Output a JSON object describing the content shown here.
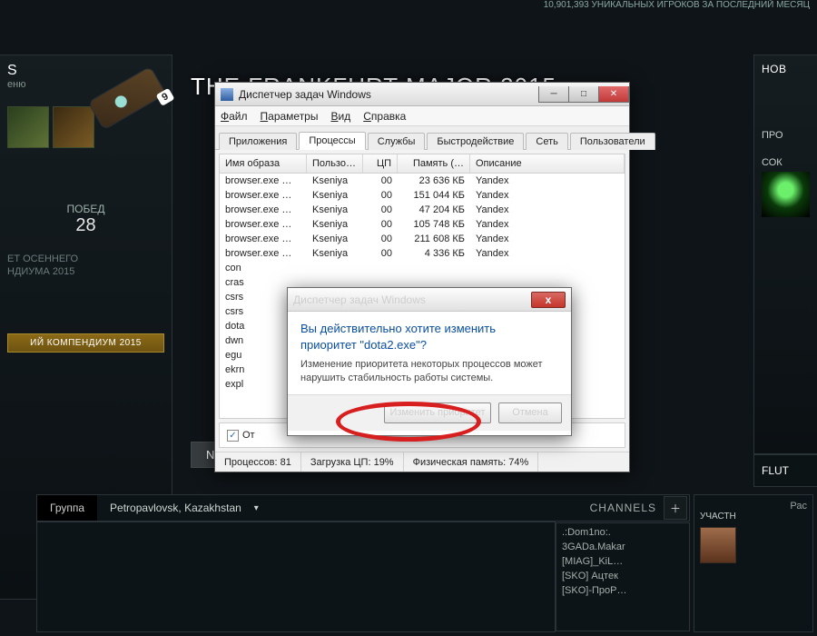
{
  "bg": {
    "stat_number": "10,901,393",
    "stat_text": "УНИКАЛЬНЫХ ИГРОКОВ ЗА ПОСЛЕДНИЙ МЕСЯЦ",
    "banner": "THE FRANKFURT MAJOR 2015",
    "next": "Next",
    "left": {
      "menu": "еню",
      "s_label": "S",
      "wand_badge": "9",
      "wins_label": "ПОБЕД",
      "wins_count": "28",
      "autumn_l1": "ЕТ ОСЕННЕГО",
      "autumn_l2": "НДИУМА 2015",
      "compendium": "ИЙ КОМПЕНДИУМ 2015"
    },
    "right": {
      "news": "НОВ",
      "pro": "ПРО",
      "cok": "СОК",
      "flut": "FLUT"
    },
    "chat": {
      "group": "Группа",
      "location": "Petropavlovsk, Kazakhstan",
      "channels_label": "CHANNELS",
      "items": [
        ".:Dom1no:.",
        "3GADa.Makar",
        "[MIAG]_KiL…",
        "[SKO] Ацтек",
        "[SKO]-ПроР…"
      ],
      "right_label": "Рас",
      "right_h": "УЧАСТН"
    }
  },
  "tm": {
    "title": "Диспетчер задач Windows",
    "menu": {
      "file": "Файл",
      "options": "Параметры",
      "view": "Вид",
      "help": "Справка"
    },
    "tabs": [
      "Приложения",
      "Процессы",
      "Службы",
      "Быстродействие",
      "Сеть",
      "Пользователи"
    ],
    "active_tab": 1,
    "columns": [
      "Имя образа",
      "Пользо…",
      "ЦП",
      "Память (…",
      "Описание"
    ],
    "rows": [
      {
        "img": "browser.exe …",
        "user": "Kseniya",
        "cpu": "00",
        "mem": "23 636 КБ",
        "desc": "Yandex"
      },
      {
        "img": "browser.exe …",
        "user": "Kseniya",
        "cpu": "00",
        "mem": "151 044 КБ",
        "desc": "Yandex"
      },
      {
        "img": "browser.exe …",
        "user": "Kseniya",
        "cpu": "00",
        "mem": "47 204 КБ",
        "desc": "Yandex"
      },
      {
        "img": "browser.exe …",
        "user": "Kseniya",
        "cpu": "00",
        "mem": "105 748 КБ",
        "desc": "Yandex"
      },
      {
        "img": "browser.exe …",
        "user": "Kseniya",
        "cpu": "00",
        "mem": "211 608 КБ",
        "desc": "Yandex"
      },
      {
        "img": "browser.exe …",
        "user": "Kseniya",
        "cpu": "00",
        "mem": "4 336 КБ",
        "desc": "Yandex"
      },
      {
        "img": "con",
        "user": "",
        "cpu": "",
        "mem": "",
        "desc": ""
      },
      {
        "img": "cras",
        "user": "",
        "cpu": "",
        "mem": "",
        "desc": ""
      },
      {
        "img": "csrs",
        "user": "",
        "cpu": "",
        "mem": "",
        "desc": ""
      },
      {
        "img": "csrs",
        "user": "",
        "cpu": "",
        "mem": "",
        "desc": ""
      },
      {
        "img": "dota",
        "user": "",
        "cpu": "",
        "mem": "",
        "desc": ""
      },
      {
        "img": "dwn",
        "user": "",
        "cpu": "",
        "mem": "",
        "desc": ""
      },
      {
        "img": "egu",
        "user": "",
        "cpu": "",
        "mem": "",
        "desc": ""
      },
      {
        "img": "ekrn",
        "user": "",
        "cpu": "",
        "mem": "",
        "desc": ""
      },
      {
        "img": "expl",
        "user": "",
        "cpu": "",
        "mem": "",
        "desc": ""
      }
    ],
    "show_all": "От",
    "status": {
      "proc": "Процессов: 81",
      "cpu": "Загрузка ЦП: 19%",
      "mem": "Физическая память: 74%"
    }
  },
  "dlg": {
    "title": "Диспетчер задач Windows",
    "main_l1": "Вы действительно хотите изменить",
    "main_l2": "приоритет \"dota2.exe\"?",
    "sub": "Изменение приоритета некоторых процессов может нарушить стабильность работы системы.",
    "btn_ok": "Изменить приоритет",
    "btn_cancel": "Отмена"
  }
}
